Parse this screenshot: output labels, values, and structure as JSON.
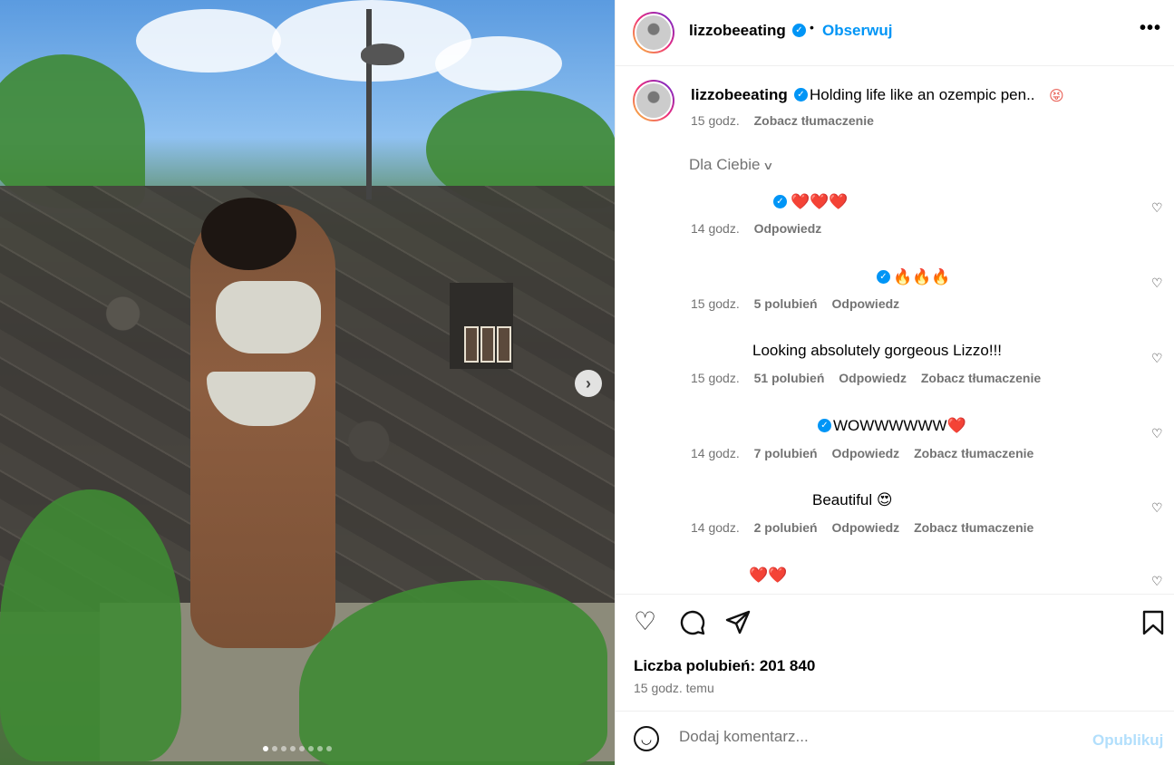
{
  "post": {
    "username": "lizzobeeating",
    "follow_label": "Obserwuj",
    "separator": "•",
    "more_label": "•••",
    "caption": "Holding life like an ozempic pen..",
    "caption_emoji": "😝",
    "caption_time": "15 godz.",
    "translate_label": "Zobacz tłumaczenie",
    "for_you_label": "Dla Ciebie",
    "media_dots": 8,
    "media_active_dot": 0
  },
  "comments": [
    {
      "text": "❤️❤️❤️",
      "time": "14 godz.",
      "likes": "",
      "reply": "Odpowiedz",
      "translate": ""
    },
    {
      "text": "🔥🔥🔥",
      "time": "15 godz.",
      "likes": "5 polubień",
      "reply": "Odpowiedz",
      "translate": ""
    },
    {
      "text": "Looking absolutely gorgeous Lizzo!!!",
      "time": "15 godz.",
      "likes": "51 polubień",
      "reply": "Odpowiedz",
      "translate": "Zobacz tłumaczenie"
    },
    {
      "text": "WOWWWWWW❤️",
      "time": "14 godz.",
      "likes": "7 polubień",
      "reply": "Odpowiedz",
      "translate": "Zobacz tłumaczenie"
    },
    {
      "text": "Beautiful 😍",
      "time": "14 godz.",
      "likes": "2 polubień",
      "reply": "Odpowiedz",
      "translate": "Zobacz tłumaczenie"
    },
    {
      "text": "❤️❤️",
      "time": "",
      "likes": "",
      "reply": "",
      "translate": ""
    }
  ],
  "footer": {
    "likes": "Liczba polubień: 201 840",
    "ago": "15 godz. temu",
    "comment_placeholder": "Dodaj komentarz...",
    "publish_label": "Opublikuj"
  },
  "colors": {
    "accent": "#0095f6",
    "muted": "#737373",
    "publish_disabled": "#b2dffc",
    "heart": "#e0253a",
    "fire": "#f2762e"
  },
  "icons": [
    "heart-icon",
    "comment-icon",
    "share-icon",
    "bookmark-icon",
    "emoji-icon",
    "verified-icon",
    "more-icon",
    "chevron-right-icon",
    "chevron-down-icon"
  ]
}
